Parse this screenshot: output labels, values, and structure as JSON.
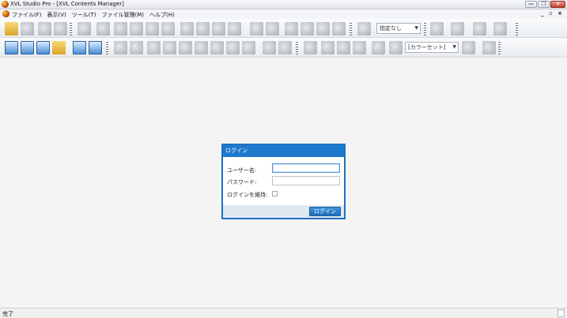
{
  "window": {
    "title": "XVL Studio Pro - [XVL Contents Manager]",
    "buttons": {
      "minimize": "—",
      "restore": "❐",
      "close": "✕"
    },
    "mdi_controls": "_ ▫ ×"
  },
  "menu": {
    "items": [
      "ファイル(F)",
      "表示(V)",
      "ツール(T)",
      "ファイル管理(M)",
      "ヘルプ(H)"
    ]
  },
  "toolbar1": {
    "view_dropdown": "指定なし"
  },
  "toolbar2": {
    "color_dropdown": "[カラーセット]"
  },
  "login": {
    "title": "ログイン",
    "username_label": "ユーザー名:",
    "username_value": "",
    "password_label": "パスワード:",
    "password_value": "",
    "remember_label": "ログインを維持:",
    "remember_checked": false,
    "submit_label": "ログイン"
  },
  "status": {
    "text": "完了"
  },
  "colors": {
    "accent": "#1d79cc",
    "workspace": "#f4f4f4"
  }
}
